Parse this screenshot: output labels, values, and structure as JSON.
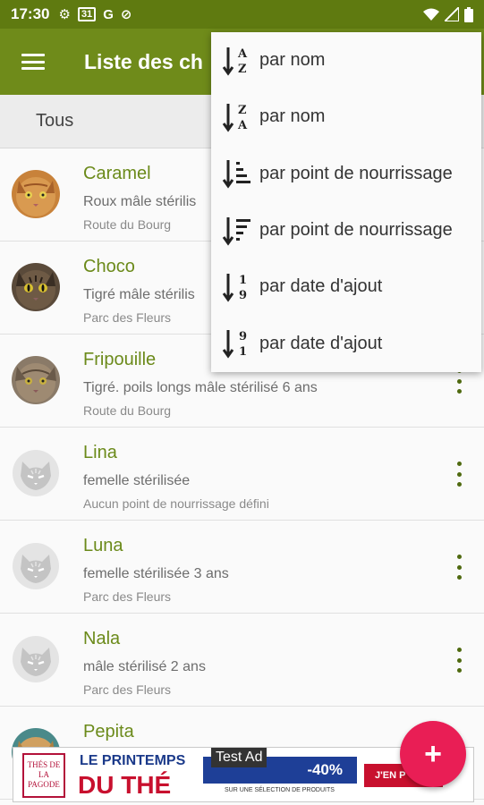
{
  "status_bar": {
    "time": "17:30",
    "icons": [
      "gear-icon",
      "calendar-icon",
      "google-icon",
      "accessibility-icon"
    ],
    "calendar_day": "31",
    "google_letter": "G",
    "right_icons": [
      "wifi-icon",
      "signal-icon",
      "battery-icon"
    ]
  },
  "app_bar": {
    "title": "Liste des ch"
  },
  "filter": {
    "label": "Tous"
  },
  "sort_menu": {
    "items": [
      {
        "label": "par nom",
        "icon": "sort-alpha-asc-icon",
        "top": "A",
        "bottom": "Z"
      },
      {
        "label": "par nom",
        "icon": "sort-alpha-desc-icon",
        "top": "Z",
        "bottom": "A"
      },
      {
        "label": "par point de nourrissage",
        "icon": "sort-list-asc-icon"
      },
      {
        "label": "par point de nourrissage",
        "icon": "sort-list-desc-icon"
      },
      {
        "label": "par date d'ajout",
        "icon": "sort-num-asc-icon",
        "top": "1",
        "bottom": "9"
      },
      {
        "label": "par date d'ajout",
        "icon": "sort-num-desc-icon",
        "top": "9",
        "bottom": "1"
      }
    ]
  },
  "cats": [
    {
      "name": "Caramel",
      "desc": "Roux mâle stérilis",
      "place": "Route du Bourg",
      "avatar": "photo"
    },
    {
      "name": "Choco",
      "desc": "Tigré mâle stérilis",
      "place": "Parc des Fleurs",
      "avatar": "photo"
    },
    {
      "name": "Fripouille",
      "desc": "Tigré. poils longs mâle stérilisé 6 ans",
      "place": "Route du Bourg",
      "avatar": "photo"
    },
    {
      "name": "Lina",
      "desc": "femelle stérilisée",
      "place": "Aucun point de nourrissage défini",
      "avatar": "placeholder"
    },
    {
      "name": "Luna",
      "desc": "femelle stérilisée 3 ans",
      "place": "Parc des Fleurs",
      "avatar": "placeholder"
    },
    {
      "name": "Nala",
      "desc": "mâle stérilisé 2 ans",
      "place": "Parc des Fleurs",
      "avatar": "placeholder"
    },
    {
      "name": "Pepita",
      "desc": "",
      "place": "",
      "avatar": "photo"
    }
  ],
  "fab": {
    "label": "+"
  },
  "ad": {
    "test_label": "Test Ad",
    "logo_text": "THÉS DE LA PAGODE",
    "title_line1": "LE PRINTEMPS",
    "title_line2": "DU THÉ",
    "ribbon_text": "-40%",
    "subtitle": "SUR UNE SÉLECTION DE PRODUITS",
    "cta": "J'EN P"
  },
  "colors": {
    "app_bar": "#6f8b1a",
    "status_bar": "#5f7a10",
    "accent_text": "#6b8a1a",
    "fab": "#e91e55"
  }
}
